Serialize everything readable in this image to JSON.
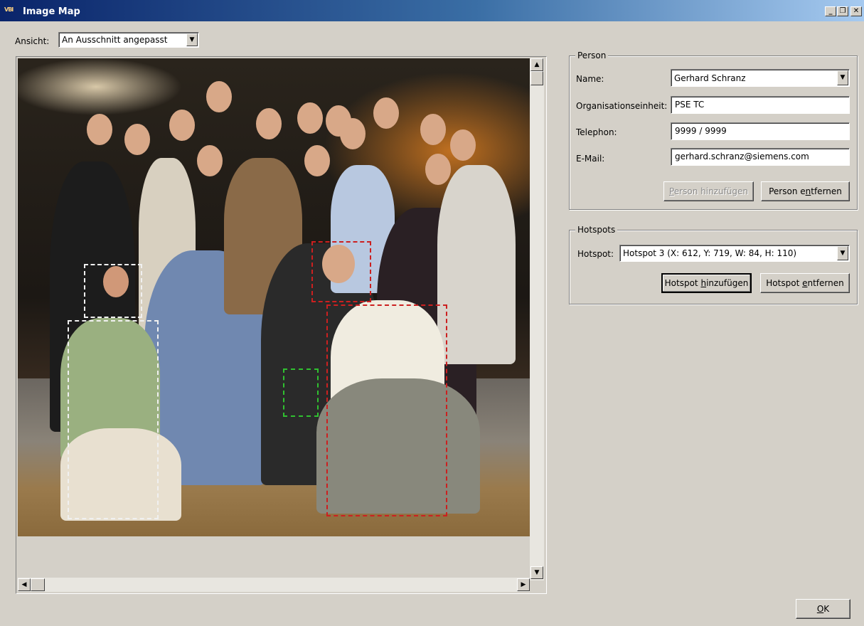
{
  "window": {
    "title": "Image Map",
    "icon_text": "VBI",
    "buttons": {
      "minimize": "_",
      "restore": "❐",
      "close": "✕"
    }
  },
  "view": {
    "label": "Ansicht:",
    "selected": "An Ausschnitt angepasst"
  },
  "person": {
    "group_title": "Person",
    "name_label": "Name:",
    "name_value": "Gerhard Schranz",
    "org_label": "Organisationseinheit:",
    "org_value": "PSE TC",
    "phone_label": "Telephon:",
    "phone_value": "9999 / 9999",
    "email_label": "E-Mail:",
    "email_value": "gerhard.schranz@siemens.com",
    "add_pre": "P",
    "add_rest": "erson hinzufügen",
    "remove_pre": "Person e",
    "remove_mn": "n",
    "remove_post": "tfernen"
  },
  "hotspots": {
    "group_title": "Hotspots",
    "label": "Hotspot:",
    "selected": "Hotspot 3 (X: 612, Y: 719, W: 84, H: 110)",
    "add_pre": "Hotspot ",
    "add_mn": "h",
    "add_post": "inzufügen",
    "remove_pre": "Hotspot ",
    "remove_mn": "e",
    "remove_post": "ntfernen"
  },
  "ok": {
    "mn": "O",
    "rest": "K"
  },
  "colors": {
    "hotspot_white": "#f0f0f0",
    "hotspot_red": "#cc2020",
    "hotspot_green": "#30c030"
  },
  "icons": [
    "dropdown-arrow-icon",
    "scroll-up-icon",
    "scroll-down-icon",
    "scroll-left-icon",
    "scroll-right-icon"
  ]
}
